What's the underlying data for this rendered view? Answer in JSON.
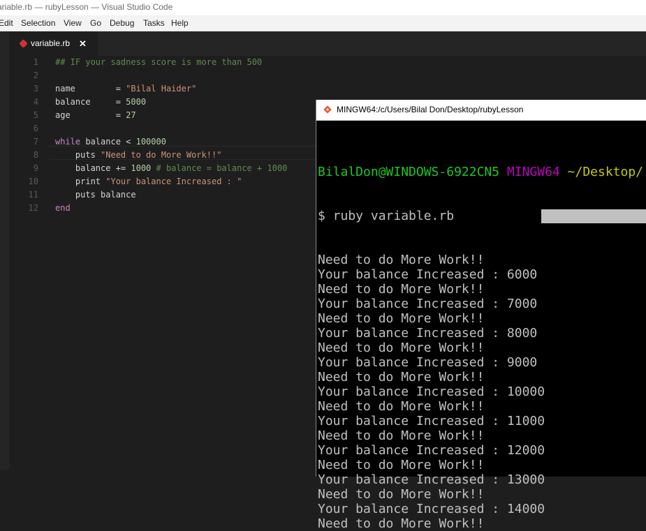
{
  "window": {
    "title": "ariable.rb — rubyLesson — Visual Studio Code"
  },
  "menu": [
    "Edit",
    "Selection",
    "View",
    "Go",
    "Debug",
    "Tasks",
    "Help"
  ],
  "tab": {
    "label": "variable.rb",
    "icon": "ruby-icon",
    "close": "✕"
  },
  "editor": {
    "line_numbers": [
      "1",
      "2",
      "3",
      "4",
      "5",
      "6",
      "7",
      "8",
      "9",
      "10",
      "11",
      "12"
    ],
    "lines": [
      [
        {
          "t": "## IF your sadness score is more than 500",
          "c": "comment"
        }
      ],
      [],
      [
        {
          "t": "name        = ",
          "c": "text"
        },
        {
          "t": "\"Bilal Haider\"",
          "c": "str"
        }
      ],
      [
        {
          "t": "balance     = ",
          "c": "text"
        },
        {
          "t": "5000",
          "c": "num"
        }
      ],
      [
        {
          "t": "age         = ",
          "c": "text"
        },
        {
          "t": "27",
          "c": "num"
        }
      ],
      [],
      [
        {
          "t": "while",
          "c": "kw"
        },
        {
          "t": " balance < ",
          "c": "text"
        },
        {
          "t": "100000",
          "c": "num"
        }
      ],
      [
        {
          "t": "    puts ",
          "c": "text"
        },
        {
          "t": "\"Need to do More Work!!\"",
          "c": "str"
        }
      ],
      [
        {
          "t": "    balance += ",
          "c": "text"
        },
        {
          "t": "1000",
          "c": "num"
        },
        {
          "t": " # balance = balance + 1000",
          "c": "comment"
        }
      ],
      [
        {
          "t": "    print ",
          "c": "text"
        },
        {
          "t": "\"Your balance Increased : \"",
          "c": "str"
        }
      ],
      [
        {
          "t": "    puts balance",
          "c": "text"
        }
      ],
      [
        {
          "t": "end",
          "c": "kw"
        }
      ]
    ]
  },
  "terminal": {
    "title": "MINGW64:/c/Users/Bilal Don/Desktop/rubyLesson",
    "prompt_user": "BilalDon@WINDOWS-6922CN5",
    "prompt_env": "MINGW64",
    "prompt_path": "~/Desktop/",
    "command": "$ ruby variable.rb",
    "output": [
      "Need to do More Work!!",
      "Your balance Increased : 6000",
      "Need to do More Work!!",
      "Your balance Increased : 7000",
      "Need to do More Work!!",
      "Your balance Increased : 8000",
      "Need to do More Work!!",
      "Your balance Increased : 9000",
      "Need to do More Work!!",
      "Your balance Increased : 10000",
      "Need to do More Work!!",
      "Your balance Increased : 11000",
      "Need to do More Work!!",
      "Your balance Increased : 12000",
      "Need to do More Work!!",
      "Your balance Increased : 13000",
      "Need to do More Work!!",
      "Your balance Increased : 14000",
      "Need to do More Work!!"
    ]
  },
  "colors": {
    "comment": "#608b4e",
    "str": "#ce9178",
    "num": "#b5cea8",
    "kw": "#c586c0",
    "text": "#d4d4d4",
    "prompt_user": "#1ec81e",
    "prompt_env": "#c000c0",
    "prompt_path": "#c8c800"
  }
}
